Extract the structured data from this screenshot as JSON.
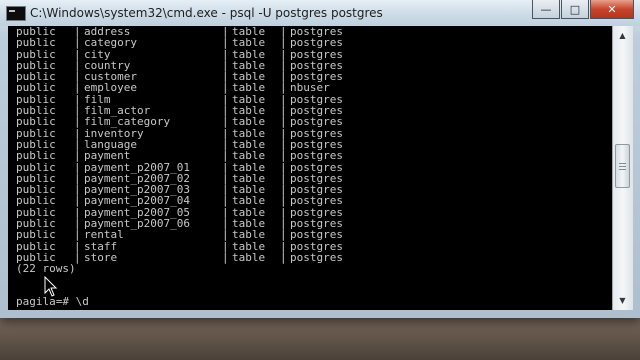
{
  "window": {
    "title": "C:\\Windows\\system32\\cmd.exe - psql  -U postgres postgres",
    "minimize_icon": "minimize-icon",
    "maximize_icon": "maximize-icon",
    "close_icon": "close-icon",
    "colors": {
      "console_bg": "#000000",
      "console_fg": "#c8c8c8"
    }
  },
  "console": {
    "separator": "|",
    "rows": [
      {
        "schema": "public",
        "name": "address",
        "type": "table",
        "owner": "postgres"
      },
      {
        "schema": "public",
        "name": "category",
        "type": "table",
        "owner": "postgres"
      },
      {
        "schema": "public",
        "name": "city",
        "type": "table",
        "owner": "postgres"
      },
      {
        "schema": "public",
        "name": "country",
        "type": "table",
        "owner": "postgres"
      },
      {
        "schema": "public",
        "name": "customer",
        "type": "table",
        "owner": "postgres"
      },
      {
        "schema": "public",
        "name": "employee",
        "type": "table",
        "owner": "nbuser"
      },
      {
        "schema": "public",
        "name": "film",
        "type": "table",
        "owner": "postgres"
      },
      {
        "schema": "public",
        "name": "film_actor",
        "type": "table",
        "owner": "postgres"
      },
      {
        "schema": "public",
        "name": "film_category",
        "type": "table",
        "owner": "postgres"
      },
      {
        "schema": "public",
        "name": "inventory",
        "type": "table",
        "owner": "postgres"
      },
      {
        "schema": "public",
        "name": "language",
        "type": "table",
        "owner": "postgres"
      },
      {
        "schema": "public",
        "name": "payment",
        "type": "table",
        "owner": "postgres"
      },
      {
        "schema": "public",
        "name": "payment_p2007_01",
        "type": "table",
        "owner": "postgres"
      },
      {
        "schema": "public",
        "name": "payment_p2007_02",
        "type": "table",
        "owner": "postgres"
      },
      {
        "schema": "public",
        "name": "payment_p2007_03",
        "type": "table",
        "owner": "postgres"
      },
      {
        "schema": "public",
        "name": "payment_p2007_04",
        "type": "table",
        "owner": "postgres"
      },
      {
        "schema": "public",
        "name": "payment_p2007_05",
        "type": "table",
        "owner": "postgres"
      },
      {
        "schema": "public",
        "name": "payment_p2007_06",
        "type": "table",
        "owner": "postgres"
      },
      {
        "schema": "public",
        "name": "rental",
        "type": "table",
        "owner": "postgres"
      },
      {
        "schema": "public",
        "name": "staff",
        "type": "table",
        "owner": "postgres"
      },
      {
        "schema": "public",
        "name": "store",
        "type": "table",
        "owner": "postgres"
      }
    ],
    "row_count": "(22 rows)",
    "prompt": "pagila=# ",
    "command": "\\d"
  },
  "scrollbar": {
    "up_icon": "scroll-up-arrow-icon",
    "down_icon": "scroll-down-arrow-icon"
  }
}
